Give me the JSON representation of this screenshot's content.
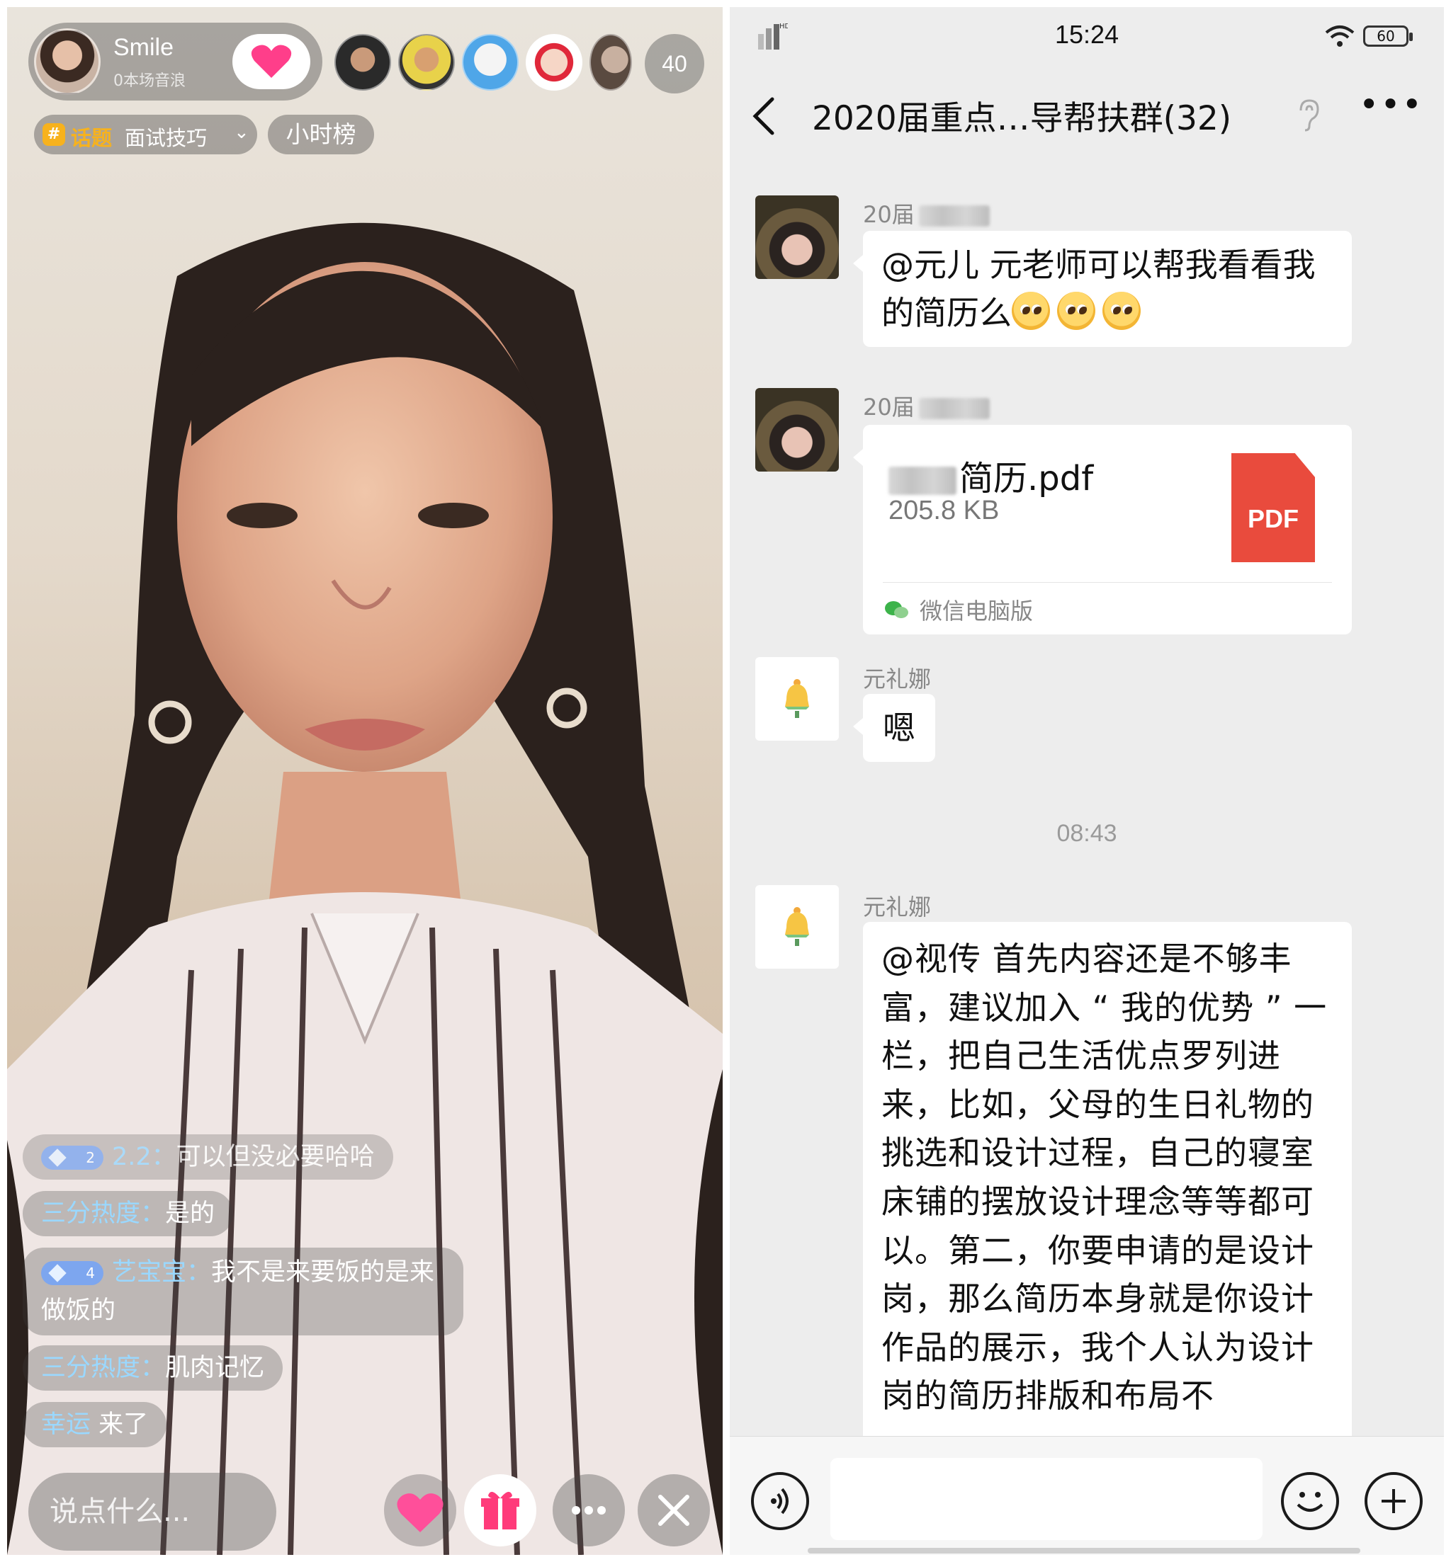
{
  "live": {
    "host_name": "Smile",
    "host_sub": "0本场音浪",
    "viewer_count": "40",
    "topic_tag": "话题",
    "topic_text": "面试技巧",
    "rank_label": "小时榜",
    "comments": [
      {
        "level": "2",
        "user": "2.2：",
        "text": "可以但没必要哈哈"
      },
      {
        "level": "",
        "user": "三分热度：",
        "text": "是的"
      },
      {
        "level": "4",
        "user": "艺宝宝：",
        "text": "我不是来要饭的是来做饭的"
      },
      {
        "level": "",
        "user": "三分热度：",
        "text": "肌肉记忆"
      },
      {
        "level": "",
        "user": "幸运",
        "text": "来了"
      }
    ],
    "say_placeholder": "说点什么...",
    "icons": [
      "heart-icon",
      "gift-icon",
      "more-icon",
      "close-icon"
    ]
  },
  "wechat": {
    "time": "15:24",
    "battery": "60",
    "title": "2020届重点…导帮扶群(32)",
    "messages": [
      {
        "nick": "20届",
        "text": "@元儿  元老师可以帮我看看我的简历么"
      },
      {
        "nick": "20届",
        "file_name": "简历.pdf",
        "file_size": "205.8 KB",
        "file_badge": "PDF",
        "file_source": "微信电脑版"
      },
      {
        "nick": "元礼娜",
        "text": "嗯"
      }
    ],
    "time_separator": "08:43",
    "long_message": {
      "nick": "元礼娜",
      "text": "@视传  首先内容还是不够丰富，建议加入 “ 我的优势 ” 一栏，把自己生活优点罗列进来，比如，父母的生日礼物的挑选和设计过程，自己的寝室床铺的摆放设计理念等等都可以。第二，你要申请的是设计岗，那么简历本身就是你设计作品的展示，我个人认为设计岗的简历排版和布局不"
    }
  }
}
